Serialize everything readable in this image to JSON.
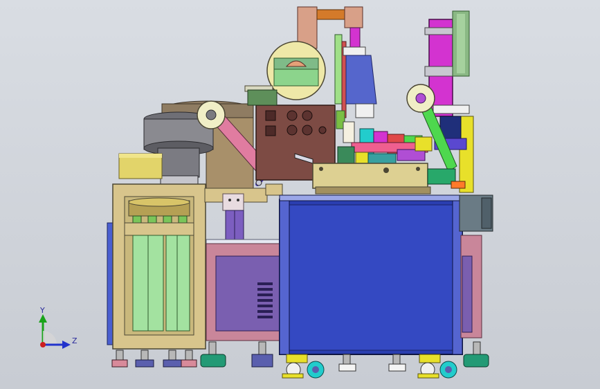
{
  "viewport": {
    "background_top": "#d9dde3",
    "background_bottom": "#c8ccd3"
  },
  "triad": {
    "y_label": "Y",
    "z_label": "Z",
    "y_color": "#19a319",
    "z_color": "#2233cc",
    "origin_color": "#cc1f1f"
  },
  "colors": {
    "frame_tan": "#d8c58c",
    "frame_outline": "#4b4633",
    "base_pink": "#c9869a",
    "panel_purple": "#7a5fb0",
    "main_blue": "#2a3eb0",
    "column_magenta": "#d333d0",
    "column_yellow": "#e8e02a",
    "brown_panel": "#7d4b44",
    "bowl_gray": "#8a8a90",
    "bowl_tan": "#a8906a",
    "cream": "#eee8a8",
    "green_arm": "#4ed84e",
    "motor_gray": "#6a7b85",
    "leveling_green": "#239a75",
    "leveling_purple": "#5a5fae",
    "light_blue": "#9aa6e8",
    "pink_arm": "#e07ca0",
    "orange_pipe": "#d47a2a",
    "pipe_copper": "#d8a088"
  }
}
